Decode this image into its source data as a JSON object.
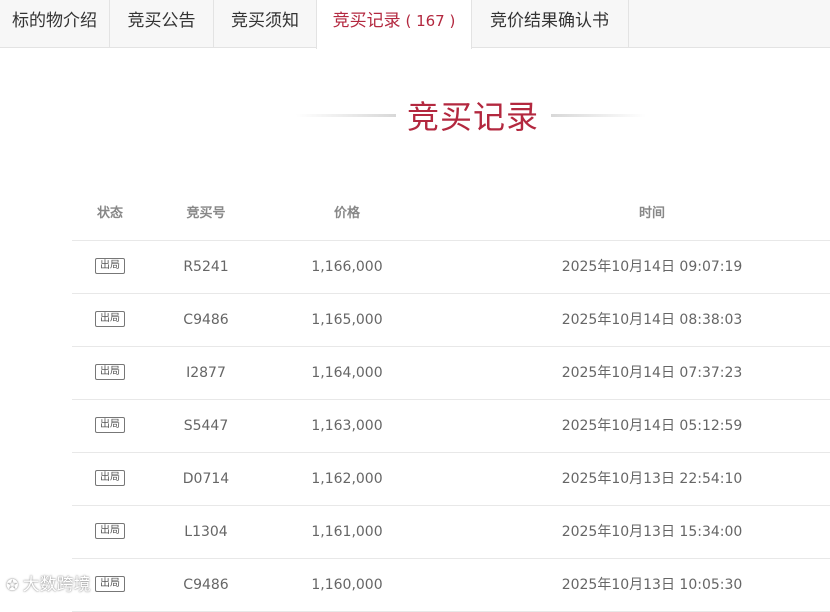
{
  "tabs": [
    {
      "label": "标的物介绍"
    },
    {
      "label": "竞买公告"
    },
    {
      "label": "竞买须知"
    },
    {
      "label": "竞买记录",
      "count": "167"
    },
    {
      "label": "竞价结果确认书"
    }
  ],
  "active_tab": 3,
  "section": {
    "title": "竞买记录"
  },
  "table": {
    "headers": {
      "status": "状态",
      "code": "竞买号",
      "price": "价格",
      "time": "时间"
    },
    "rows": [
      {
        "status": "出局",
        "code": "R5241",
        "price": "1,166,000",
        "time": "2025年10月14日 09:07:19"
      },
      {
        "status": "出局",
        "code": "C9486",
        "price": "1,165,000",
        "time": "2025年10月14日 08:38:03"
      },
      {
        "status": "出局",
        "code": "I2877",
        "price": "1,164,000",
        "time": "2025年10月14日 07:37:23"
      },
      {
        "status": "出局",
        "code": "S5447",
        "price": "1,163,000",
        "time": "2025年10月14日 05:12:59"
      },
      {
        "status": "出局",
        "code": "D0714",
        "price": "1,162,000",
        "time": "2025年10月13日 22:54:10"
      },
      {
        "status": "出局",
        "code": "L1304",
        "price": "1,161,000",
        "time": "2025年10月13日 15:34:00"
      },
      {
        "status": "出局",
        "code": "C9486",
        "price": "1,160,000",
        "time": "2025年10月13日 10:05:30"
      }
    ]
  },
  "watermark": {
    "text": "大数跨境",
    "icon": "logo-icon"
  },
  "colors": {
    "accent": "#b3283f",
    "tab_bg": "#f7f7f7",
    "border": "#e8e8e8"
  }
}
